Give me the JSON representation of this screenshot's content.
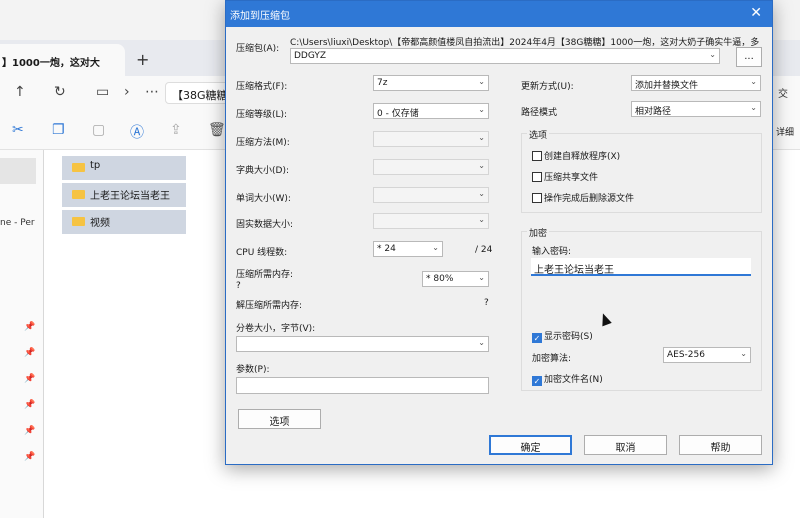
{
  "explorer": {
    "tab_title": "】1000一炮，这对大",
    "address_text": "【38G糖糖",
    "right_text": "交",
    "detail_text": "详细",
    "left_items": [
      "ne - Per"
    ],
    "files": [
      "tp",
      "上老王论坛当老王",
      "视频"
    ]
  },
  "dialog": {
    "title": "添加到压缩包",
    "archive_label": "压缩包(A):",
    "archive_path": "C:\\Users\\liuxi\\Desktop\\【帝都高颜值楼凤自拍流出】2024年4月【38G糖糖】1000一炮，这对大奶子确实牛逼，多",
    "archive_name": "DDGYZ",
    "browse_label": "...",
    "format_label": "压缩格式(F):",
    "format_value": "7z",
    "level_label": "压缩等级(L):",
    "level_value": "0 - 仅存储",
    "method_label": "压缩方法(M):",
    "dict_label": "字典大小(D):",
    "word_label": "单词大小(W):",
    "solid_label": "固实数据大小:",
    "cpu_label": "CPU 线程数:",
    "cpu_value": "* 24",
    "cpu_total": "/ 24",
    "mem_label": "压缩所需内存:",
    "mem_q": "?",
    "mem_value": "* 80%",
    "decomp_label": "解压缩所需内存:",
    "decomp_q": "?",
    "split_label": "分卷大小，字节(V):",
    "params_label": "参数(P):",
    "options_button": "选项",
    "update_label": "更新方式(U):",
    "update_value": "添加并替换文件",
    "path_label": "路径模式",
    "path_value": "相对路径",
    "options_group": "选项",
    "opt_sfx": "创建自释放程序(X)",
    "opt_shared": "压缩共享文件",
    "opt_delete": "操作完成后删除源文件",
    "encrypt_group": "加密",
    "password_label": "输入密码:",
    "password_value": "上老王论坛当老王",
    "show_password": "显示密码(S)",
    "method_enc_label": "加密算法:",
    "method_enc_value": "AES-256",
    "encrypt_names": "加密文件名(N)",
    "ok": "确定",
    "cancel": "取消",
    "help": "帮助"
  }
}
